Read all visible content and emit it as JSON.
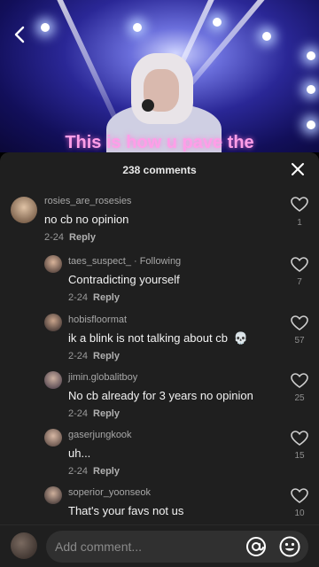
{
  "video": {
    "caption": "This is how u pave the"
  },
  "sheet": {
    "count_label": "238 comments"
  },
  "comments": [
    {
      "username": "rosies_are_rosesies",
      "tag": "",
      "text": "no cb no opinion",
      "date": "2-24",
      "reply": "Reply",
      "likes": "1",
      "emoji": ""
    },
    {
      "username": "taes_suspect_",
      "tag": " · Following",
      "text": "Contradicting yourself",
      "date": "2-24",
      "reply": "Reply",
      "likes": "7",
      "emoji": ""
    },
    {
      "username": "hobisfloormat",
      "tag": "",
      "text": "ik a blink is not talking about cb",
      "date": "2-24",
      "reply": "Reply",
      "likes": "57",
      "emoji": "💀"
    },
    {
      "username": "jimin.globalitboy",
      "tag": "",
      "text": "No cb already for 3 years no opinion",
      "date": "2-24",
      "reply": "Reply",
      "likes": "25",
      "emoji": ""
    },
    {
      "username": "gaserjungkook",
      "tag": "",
      "text": "uh...",
      "date": "2-24",
      "reply": "Reply",
      "likes": "15",
      "emoji": ""
    },
    {
      "username": "soperior_yoonseok",
      "tag": "",
      "text": "That's your favs not us",
      "date": "",
      "reply": "",
      "likes": "10",
      "emoji": ""
    }
  ],
  "composer": {
    "placeholder": "Add comment..."
  },
  "colors": {
    "sheet_bg": "#1f1f1f",
    "caption": "#ff9ee8"
  },
  "icons": {
    "back": "back-arrow-icon",
    "close": "close-icon",
    "like": "heart-outline-icon",
    "mention": "at-sign-icon",
    "emoji": "emoji-icon"
  }
}
